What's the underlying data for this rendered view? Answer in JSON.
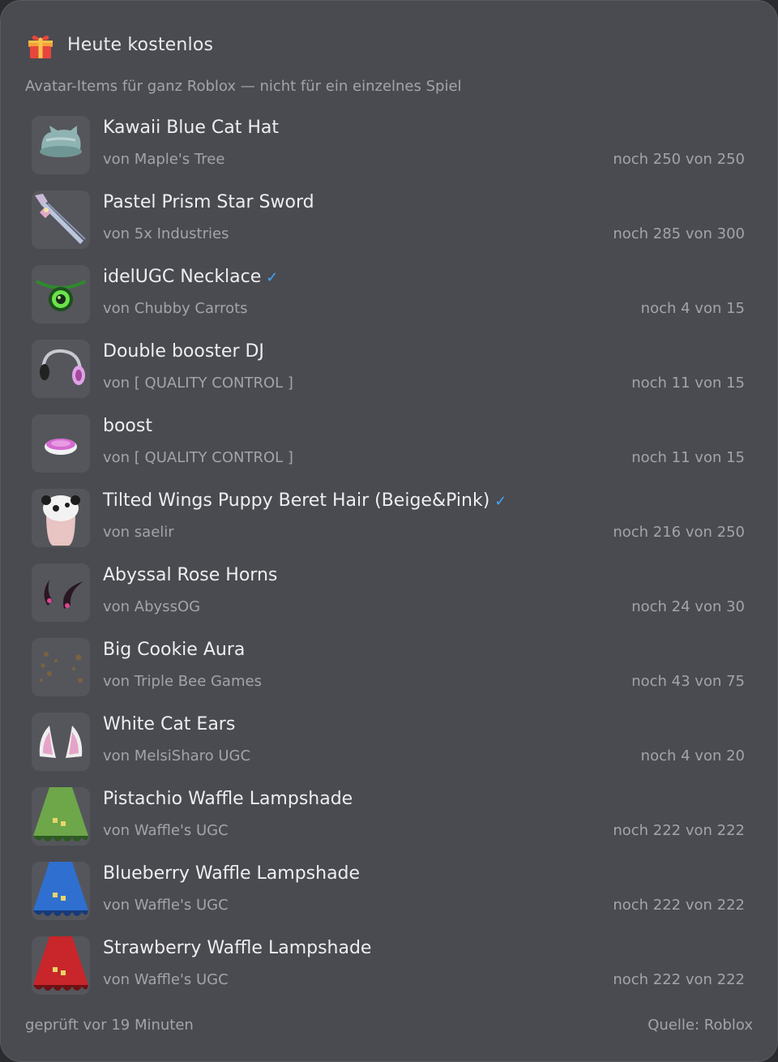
{
  "header": {
    "icon": "gift-icon",
    "title": "Heute kostenlos"
  },
  "subtitle": "Avatar-Items für ganz Roblox — nicht für ein einzelnes Spiel",
  "items": [
    {
      "name": "Kawaii Blue Cat Hat",
      "creator": "von Maple's Tree",
      "stock": "noch 250 von 250",
      "verified": false,
      "icon": "cat-hat-icon"
    },
    {
      "name": "Pastel Prism Star Sword",
      "creator": "von 5x Industries",
      "stock": "noch 285 von 300",
      "verified": false,
      "icon": "sword-icon"
    },
    {
      "name": "idelUGC Necklace",
      "creator": "von Chubby Carrots",
      "stock": "noch 4 von 15",
      "verified": true,
      "icon": "necklace-icon"
    },
    {
      "name": "Double booster DJ",
      "creator": "von [ QUALITY CONTROL ]",
      "stock": "noch 11 von 15",
      "verified": false,
      "icon": "headphones-icon"
    },
    {
      "name": "boost",
      "creator": "von [ QUALITY CONTROL ]",
      "stock": "noch 11 von 15",
      "verified": false,
      "icon": "disc-icon"
    },
    {
      "name": "Tilted Wings Puppy Beret Hair (Beige&Pink)",
      "creator": "von saelir",
      "stock": "noch 216 von 250",
      "verified": true,
      "icon": "hair-icon"
    },
    {
      "name": "Abyssal Rose Horns",
      "creator": "von AbyssOG",
      "stock": "noch 24 von 30",
      "verified": false,
      "icon": "horns-icon"
    },
    {
      "name": "Big Cookie Aura",
      "creator": "von Triple Bee Games",
      "stock": "noch 43 von 75",
      "verified": false,
      "icon": "cookie-aura-icon"
    },
    {
      "name": "White Cat Ears",
      "creator": "von MelsiSharo UGC",
      "stock": "noch 4 von 20",
      "verified": false,
      "icon": "cat-ears-icon"
    },
    {
      "name": "Pistachio Waffle Lampshade",
      "creator": "von Waffle's UGC",
      "stock": "noch 222 von 222",
      "verified": false,
      "icon": "lampshade-green-icon"
    },
    {
      "name": "Blueberry Waffle Lampshade",
      "creator": "von Waffle's UGC",
      "stock": "noch 222 von 222",
      "verified": false,
      "icon": "lampshade-blue-icon"
    },
    {
      "name": "Strawberry Waffle Lampshade",
      "creator": "von Waffle's UGC",
      "stock": "noch 222 von 222",
      "verified": false,
      "icon": "lampshade-red-icon"
    }
  ],
  "verified_mark": "✓",
  "footer": {
    "checked": "geprüft vor 19 Minuten",
    "source": "Quelle: Roblox"
  },
  "colors": {
    "panel": "#4a4b50",
    "verified": "#3fa7ff",
    "text_muted": "#a3a4a9"
  }
}
